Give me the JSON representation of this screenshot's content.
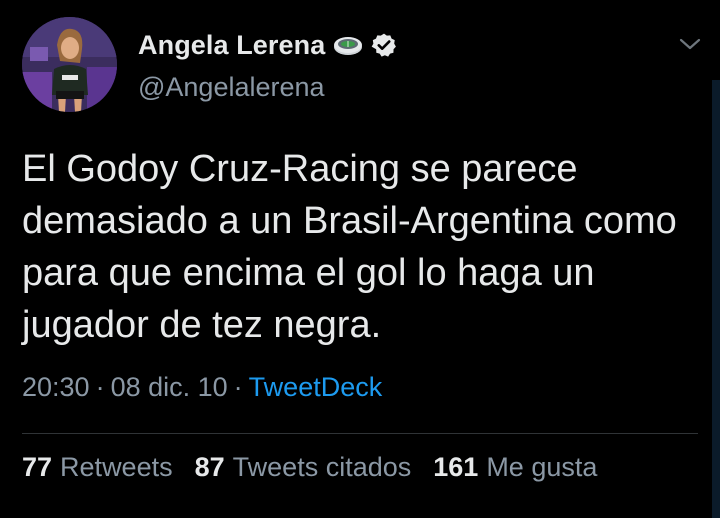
{
  "author": {
    "display_name": "Angela Lerena",
    "handle": "@Angelalerena",
    "badge_icon": "stadium-emoji-icon",
    "verified_icon": "verified-badge-icon"
  },
  "tweet": {
    "text": "El Godoy Cruz-Racing se parece demasiado a un Brasil-Argentina como para que encima el gol lo haga un jugador de tez negra.",
    "time": "20:30",
    "separator": "·",
    "date": "08 dic. 10",
    "source": "TweetDeck"
  },
  "stats": {
    "retweets_count": "77",
    "retweets_label": "Retweets",
    "quotes_count": "87",
    "quotes_label": "Tweets citados",
    "likes_count": "161",
    "likes_label": "Me gusta"
  },
  "colors": {
    "background": "#000000",
    "text": "#e7e9ea",
    "secondary_text": "#8b98a5",
    "link": "#1d9bf0",
    "divider": "#2f3336"
  },
  "icons": {
    "more_menu": "chevron-down-icon"
  }
}
